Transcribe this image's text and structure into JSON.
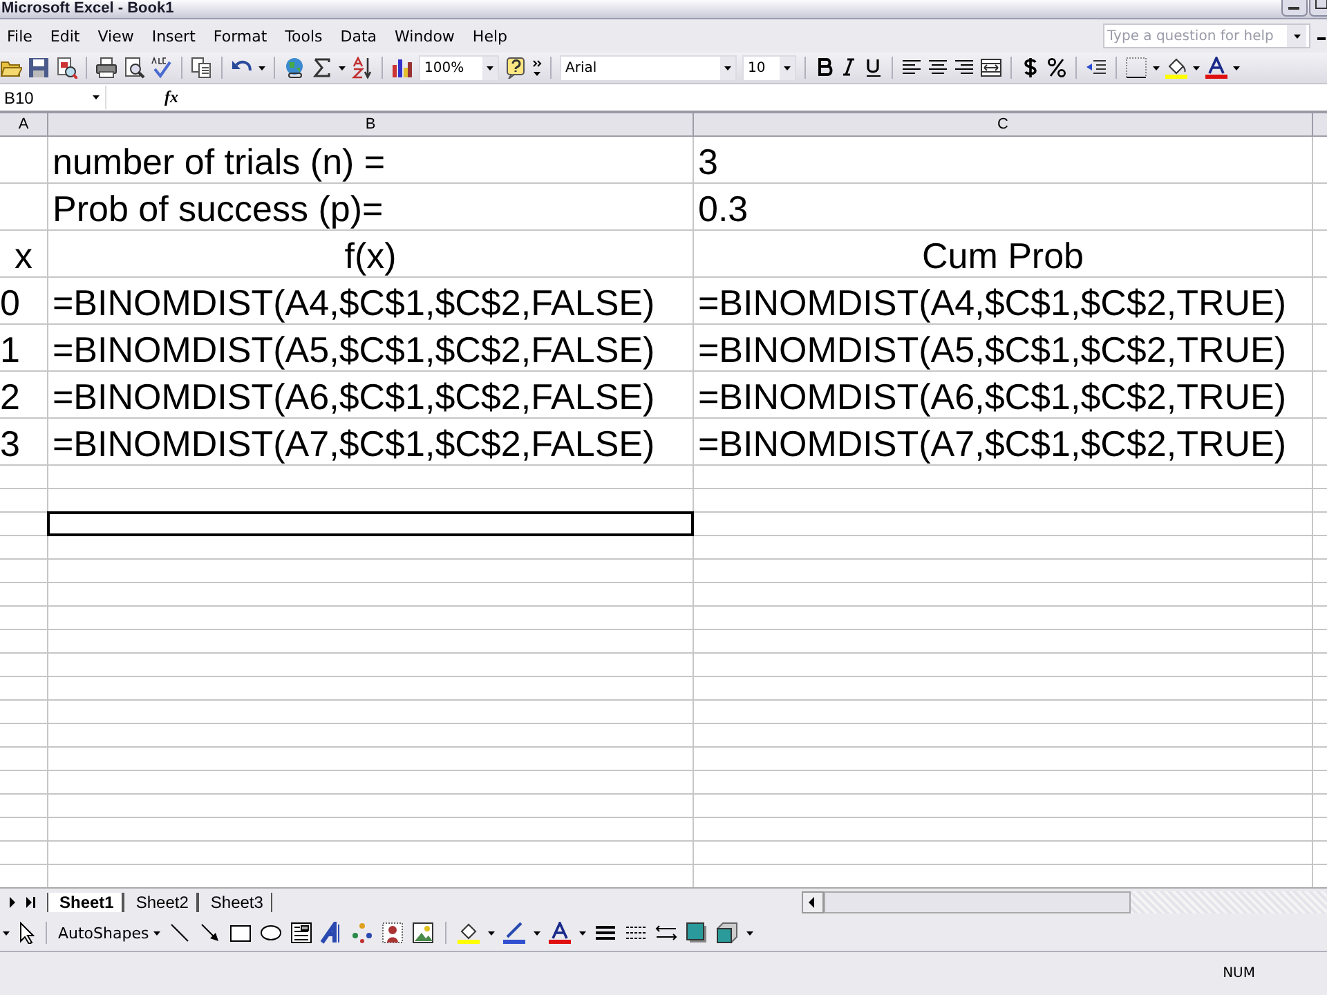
{
  "window": {
    "title": "Microsoft Excel - Book1"
  },
  "menu": [
    {
      "label": "File"
    },
    {
      "label": "Edit"
    },
    {
      "label": "View"
    },
    {
      "label": "Insert"
    },
    {
      "label": "Format"
    },
    {
      "label": "Tools"
    },
    {
      "label": "Data"
    },
    {
      "label": "Window"
    },
    {
      "label": "Help"
    }
  ],
  "help_box": {
    "placeholder": "Type a question for help"
  },
  "toolbar": {
    "zoom": "100%",
    "font": "Arial",
    "font_size": "10"
  },
  "formula_bar": {
    "name_box": "B10",
    "function_label": "fx"
  },
  "columns": [
    "A",
    "B",
    "C"
  ],
  "rows": [
    {
      "kind": "label",
      "b": "number of trials (n) =",
      "c": "3"
    },
    {
      "kind": "label",
      "b": "Prob of success (p)=",
      "c": "0.3"
    },
    {
      "kind": "header",
      "a": "x",
      "b": "f(x)",
      "c": "Cum Prob"
    },
    {
      "kind": "data",
      "a": "0",
      "b": "=BINOMDIST(A4,$C$1,$C$2,FALSE)",
      "c": "=BINOMDIST(A4,$C$1,$C$2,TRUE)"
    },
    {
      "kind": "data",
      "a": "1",
      "b": "=BINOMDIST(A5,$C$1,$C$2,FALSE)",
      "c": "=BINOMDIST(A5,$C$1,$C$2,TRUE)"
    },
    {
      "kind": "data",
      "a": "2",
      "b": "=BINOMDIST(A6,$C$1,$C$2,FALSE)",
      "c": "=BINOMDIST(A6,$C$1,$C$2,TRUE)"
    },
    {
      "kind": "data",
      "a": "3",
      "b": "=BINOMDIST(A7,$C$1,$C$2,FALSE)",
      "c": "=BINOMDIST(A7,$C$1,$C$2,TRUE)"
    }
  ],
  "sheet_tabs": [
    {
      "label": "Sheet1",
      "selected": true
    },
    {
      "label": "Sheet2",
      "selected": false
    },
    {
      "label": "Sheet3",
      "selected": false
    }
  ],
  "drawing_toolbar": {
    "autoshapes": "AutoShapes"
  },
  "status_bar": {
    "num": "NUM"
  }
}
